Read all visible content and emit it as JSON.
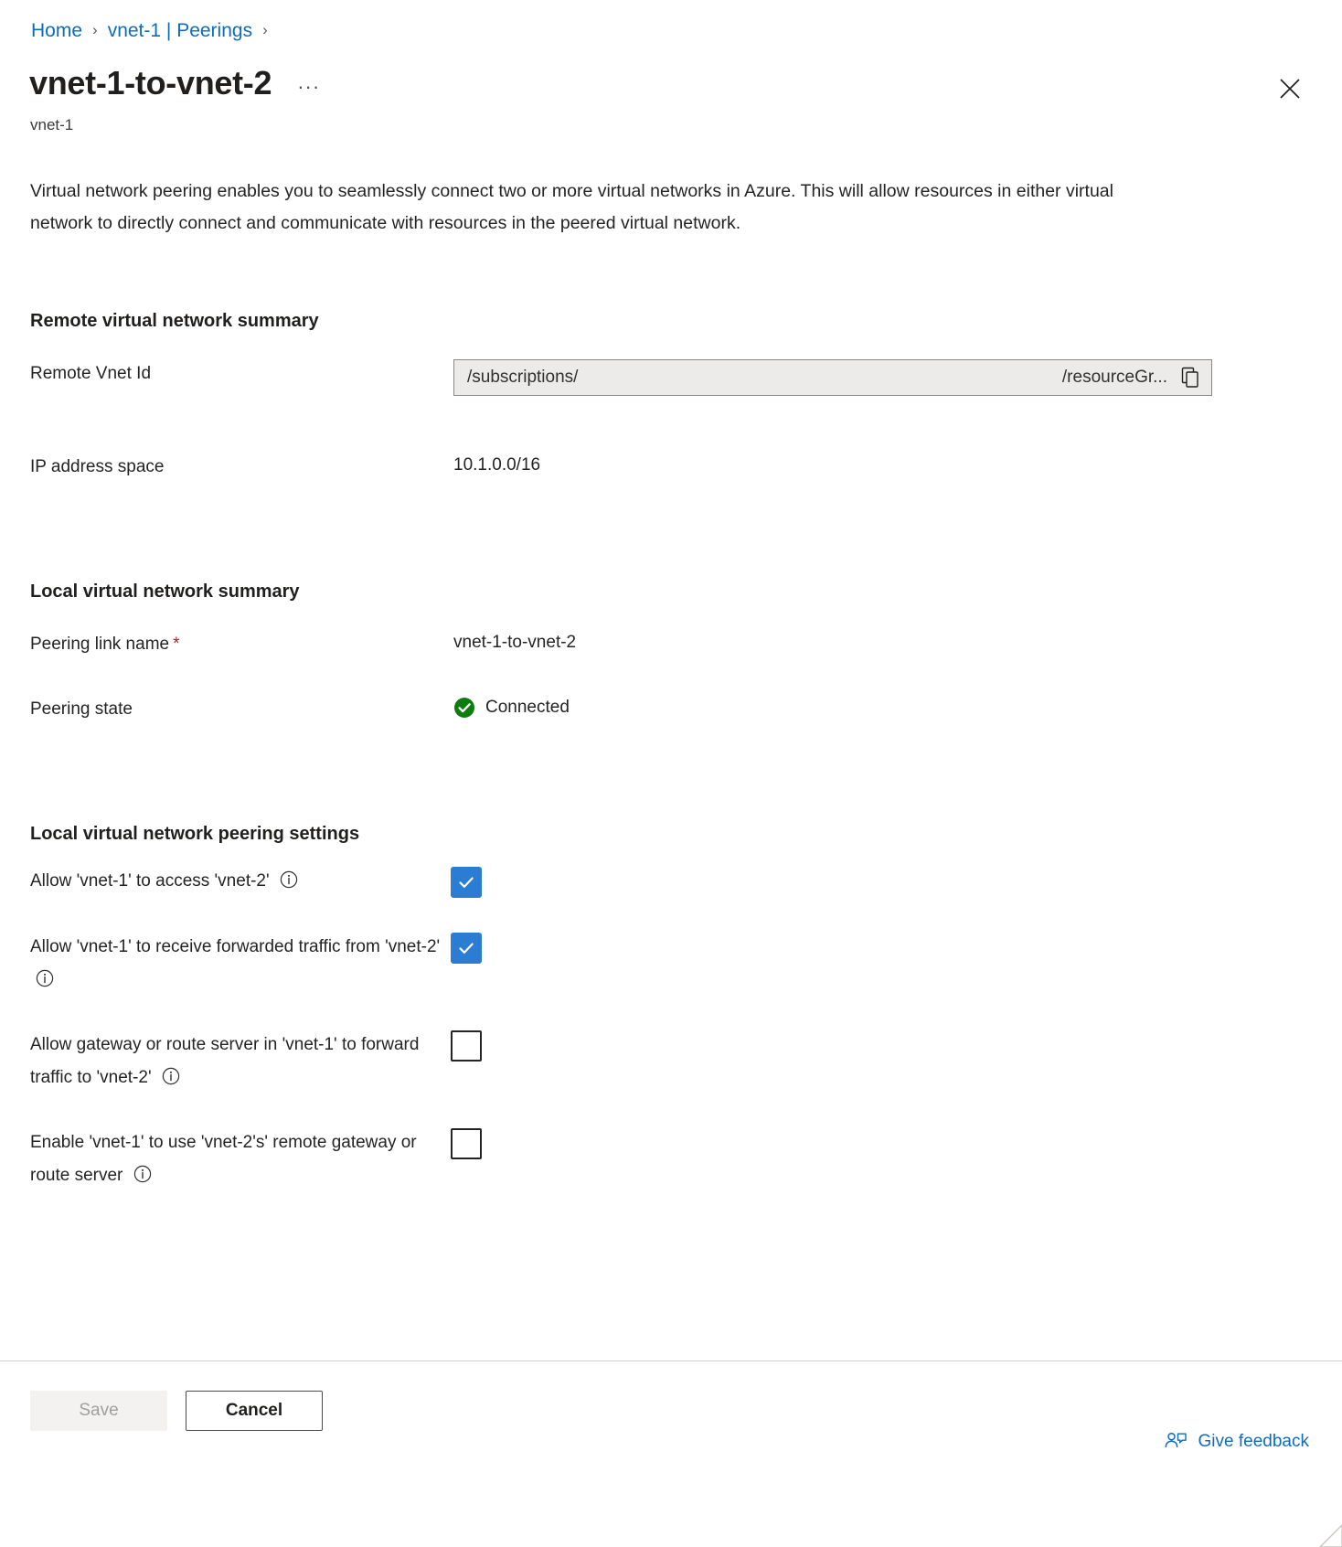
{
  "breadcrumb": {
    "items": [
      {
        "label": "Home"
      },
      {
        "label": "vnet-1 | Peerings"
      }
    ],
    "separator": "›"
  },
  "header": {
    "title": "vnet-1-to-vnet-2",
    "subtitle": "vnet-1",
    "more_label": "···",
    "close_icon": "close-icon"
  },
  "description": "Virtual network peering enables you to seamlessly connect two or more virtual networks in Azure. This will allow resources in either virtual network to directly connect and communicate with resources in the peered virtual network.",
  "remote_summary": {
    "heading": "Remote virtual network summary",
    "vnet_id": {
      "label": "Remote Vnet Id",
      "value_start": "/subscriptions/",
      "value_end": "/resourceGr...",
      "copy_icon": "copy-icon"
    },
    "ip_space": {
      "label": "IP address space",
      "value": "10.1.0.0/16"
    }
  },
  "local_summary": {
    "heading": "Local virtual network summary",
    "link_name": {
      "label": "Peering link name",
      "required_marker": "*",
      "value": "vnet-1-to-vnet-2"
    },
    "peering_state": {
      "label": "Peering state",
      "value": "Connected",
      "status_icon": "check-circle-icon",
      "status_color": "#107c10"
    }
  },
  "peering_settings": {
    "heading": "Local virtual network peering settings",
    "checkboxes": [
      {
        "label": "Allow 'vnet-1' to access 'vnet-2'",
        "checked": true,
        "info_icon": "info-icon"
      },
      {
        "label": "Allow 'vnet-1' to receive forwarded traffic from 'vnet-2'",
        "checked": true,
        "info_icon": "info-icon"
      },
      {
        "label": "Allow gateway or route server in 'vnet-1' to forward traffic to 'vnet-2'",
        "checked": false,
        "info_icon": "info-icon"
      },
      {
        "label": "Enable 'vnet-1' to use 'vnet-2's' remote gateway or route server",
        "checked": false,
        "info_icon": "info-icon"
      }
    ]
  },
  "footer": {
    "save_label": "Save",
    "cancel_label": "Cancel",
    "feedback_label": "Give feedback",
    "feedback_icon": "feedback-person-icon"
  },
  "colors": {
    "link": "#0f6cbd",
    "checkbox_checked": "#2b7cd3",
    "status_connected": "#107c10",
    "required_star": "#a4262c"
  }
}
